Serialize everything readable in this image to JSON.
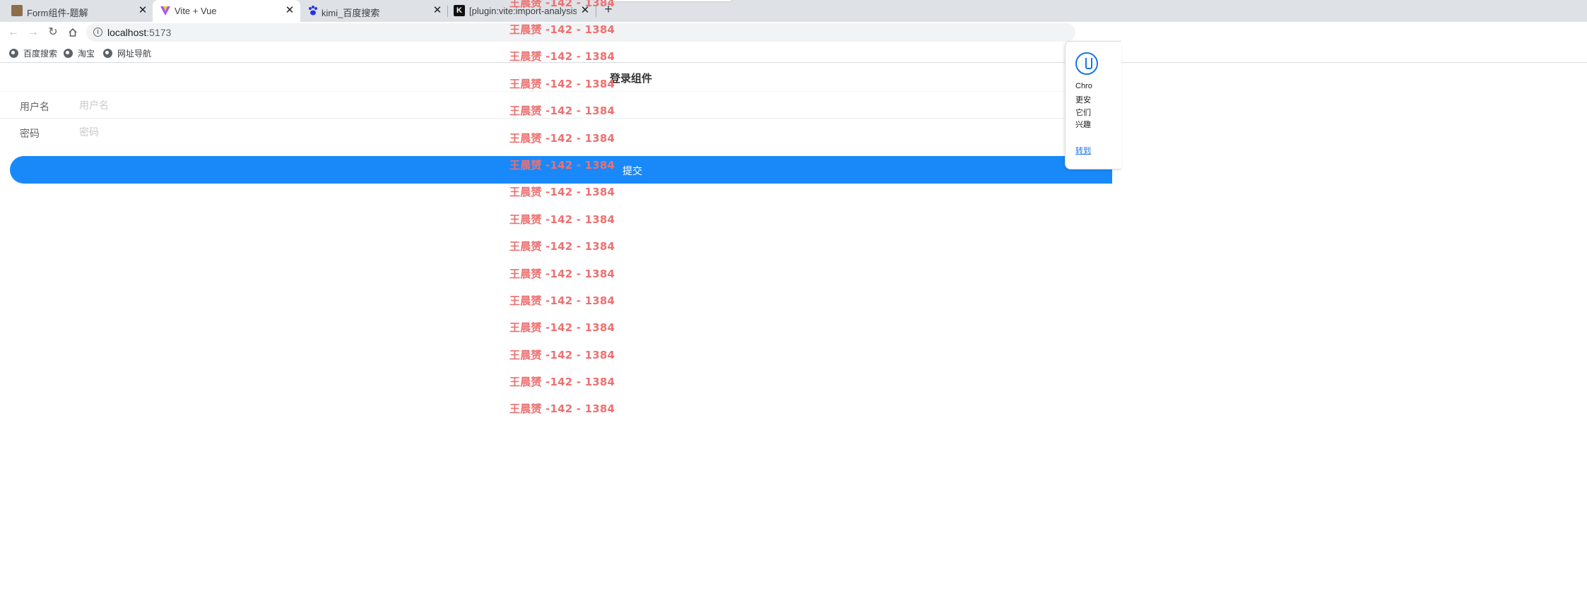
{
  "browser": {
    "tabs": [
      {
        "title": "Form组件-题解",
        "favicon": "avatar-icon",
        "active": false
      },
      {
        "title": "Vite + Vue",
        "favicon": "vite-icon",
        "active": true
      },
      {
        "title": "kimi_百度搜索",
        "favicon": "baidu-paw-icon",
        "active": false
      },
      {
        "title": "[plugin:vite:import-analysis] -",
        "favicon": "kimi-k-icon",
        "active": false
      }
    ],
    "close_glyph": "✕",
    "new_tab_glyph": "+",
    "url_host": "localhost",
    "url_port": ":5173",
    "bookmarks": [
      {
        "label": "百度搜索",
        "icon": "globe-icon"
      },
      {
        "label": "淘宝",
        "icon": "globe-icon"
      },
      {
        "label": "网址导航",
        "icon": "globe-icon"
      }
    ]
  },
  "page": {
    "nav_title": "登录组件",
    "username": {
      "label": "用户名",
      "placeholder": "用户名",
      "value": ""
    },
    "password": {
      "label": "密码",
      "placeholder": "密码",
      "value": ""
    },
    "submit_label": "提交"
  },
  "watermark": {
    "text": "王晨赟 -142 - 1384",
    "color": "#ee7070"
  },
  "side_popup": {
    "lines": [
      "Chro",
      "更安",
      "它们",
      "兴趣"
    ],
    "link": "转到"
  },
  "colors": {
    "primary": "#1989fa",
    "tabstrip": "#dee1e6"
  }
}
